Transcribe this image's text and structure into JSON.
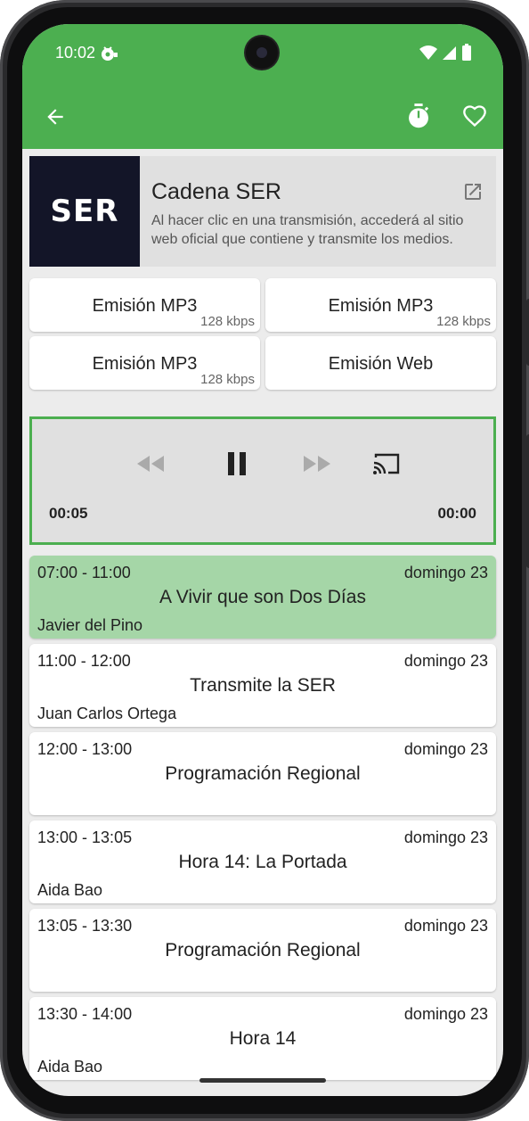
{
  "status_bar": {
    "time": "10:02"
  },
  "toolbar": {
    "back_label": "",
    "timer_label": "",
    "favorite_label": ""
  },
  "colors": {
    "accent": "#4caf50",
    "active_program": "#a5d6a7",
    "logo_bg": "#131528"
  },
  "station": {
    "logo_text": "SER",
    "name": "Cadena SER",
    "description": "Al hacer clic en una transmisión, accederá al sitio web oficial que contiene y transmite los medios."
  },
  "streams": [
    {
      "label": "Emisión MP3",
      "rate": "128 kbps"
    },
    {
      "label": "Emisión MP3",
      "rate": "128 kbps"
    },
    {
      "label": "Emisión MP3",
      "rate": "128 kbps"
    },
    {
      "label": "Emisión Web",
      "rate": ""
    }
  ],
  "player": {
    "elapsed": "00:05",
    "remaining": "00:00",
    "state": "playing"
  },
  "programs": [
    {
      "time": "07:00 - 11:00",
      "day": "domingo 23",
      "title": "A Vivir que son Dos Días",
      "host": "Javier del Pino",
      "active": true
    },
    {
      "time": "11:00 - 12:00",
      "day": "domingo 23",
      "title": "Transmite la SER",
      "host": "Juan Carlos Ortega",
      "active": false
    },
    {
      "time": "12:00 - 13:00",
      "day": "domingo 23",
      "title": "Programación Regional",
      "host": "",
      "active": false
    },
    {
      "time": "13:00 - 13:05",
      "day": "domingo 23",
      "title": "Hora 14: La Portada",
      "host": "Aida Bao",
      "active": false
    },
    {
      "time": "13:05 - 13:30",
      "day": "domingo 23",
      "title": "Programación Regional",
      "host": "",
      "active": false
    },
    {
      "time": "13:30 - 14:00",
      "day": "domingo 23",
      "title": "Hora 14",
      "host": "Aida Bao",
      "active": false
    }
  ]
}
